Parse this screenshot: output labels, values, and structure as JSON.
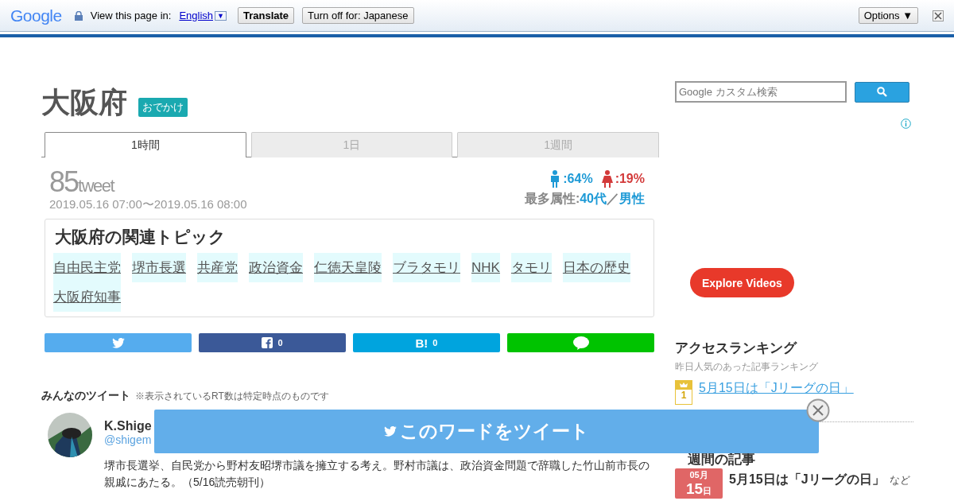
{
  "translate_bar": {
    "logo": "Google",
    "prompt": "View this page in:",
    "language": "English",
    "dropdown": "▼",
    "translate_button": "Translate",
    "turn_off_button": "Turn off for: Japanese",
    "options_button": "Options ▼"
  },
  "header": {
    "title": "大阪府",
    "tag": "おでかけ"
  },
  "tabs": [
    {
      "label": "1時間",
      "selected": true
    },
    {
      "label": "1日",
      "selected": false
    },
    {
      "label": "1週間",
      "selected": false
    }
  ],
  "stats": {
    "count": "85",
    "unit": "tweet",
    "period": "2019.05.16 07:00〜2019.05.16 08:00",
    "male": ":64%",
    "female": ":19%",
    "attribute_label": "最多属性:",
    "attribute_age": "40代",
    "attribute_sep": "／",
    "attribute_gender": "男性"
  },
  "topics": {
    "title": "大阪府の関連トピック",
    "items": [
      "自由民主党",
      "堺市長選",
      "共産党",
      "政治資金",
      "仁徳天皇陵",
      "ブラタモリ",
      "NHK",
      "タモリ",
      "日本の歴史",
      "大阪府知事"
    ]
  },
  "share_buttons": [
    {
      "kind": "twitter"
    },
    {
      "kind": "facebook",
      "count": "0"
    },
    {
      "kind": "hatena",
      "label": "B!",
      "count": "0"
    },
    {
      "kind": "line"
    }
  ],
  "tweets_section": {
    "title": "みんなのツイート",
    "note": "※表示されているRT数は特定時点のものです",
    "tweets": [
      {
        "name": "K.Shige",
        "handle": "@shigem",
        "text": "堺市長選挙、自民党から野村友昭堺市議を擁立する考え。野村市議は、政治資金問題で辞職した竹山前市長の親戚にあたる。（5/16読売朝刊）"
      }
    ]
  },
  "banner": {
    "label": "このワードをツイート"
  },
  "sidebar": {
    "search_placeholder": "Google カスタム検索",
    "explore_button": "Explore Videos",
    "ranking": {
      "title": "アクセスランキング",
      "subtitle": "昨日人気のあった記事ランキング",
      "items": [
        {
          "rank": "1",
          "title": "5月15日は「Jリーグの日」"
        }
      ]
    },
    "weekly": {
      "title": "週間の記事",
      "items": [
        {
          "month": "05月",
          "day": "15",
          "day_unit": "日",
          "title": "5月15日は「Jリーグの日」",
          "suffix": "など"
        }
      ]
    }
  }
}
